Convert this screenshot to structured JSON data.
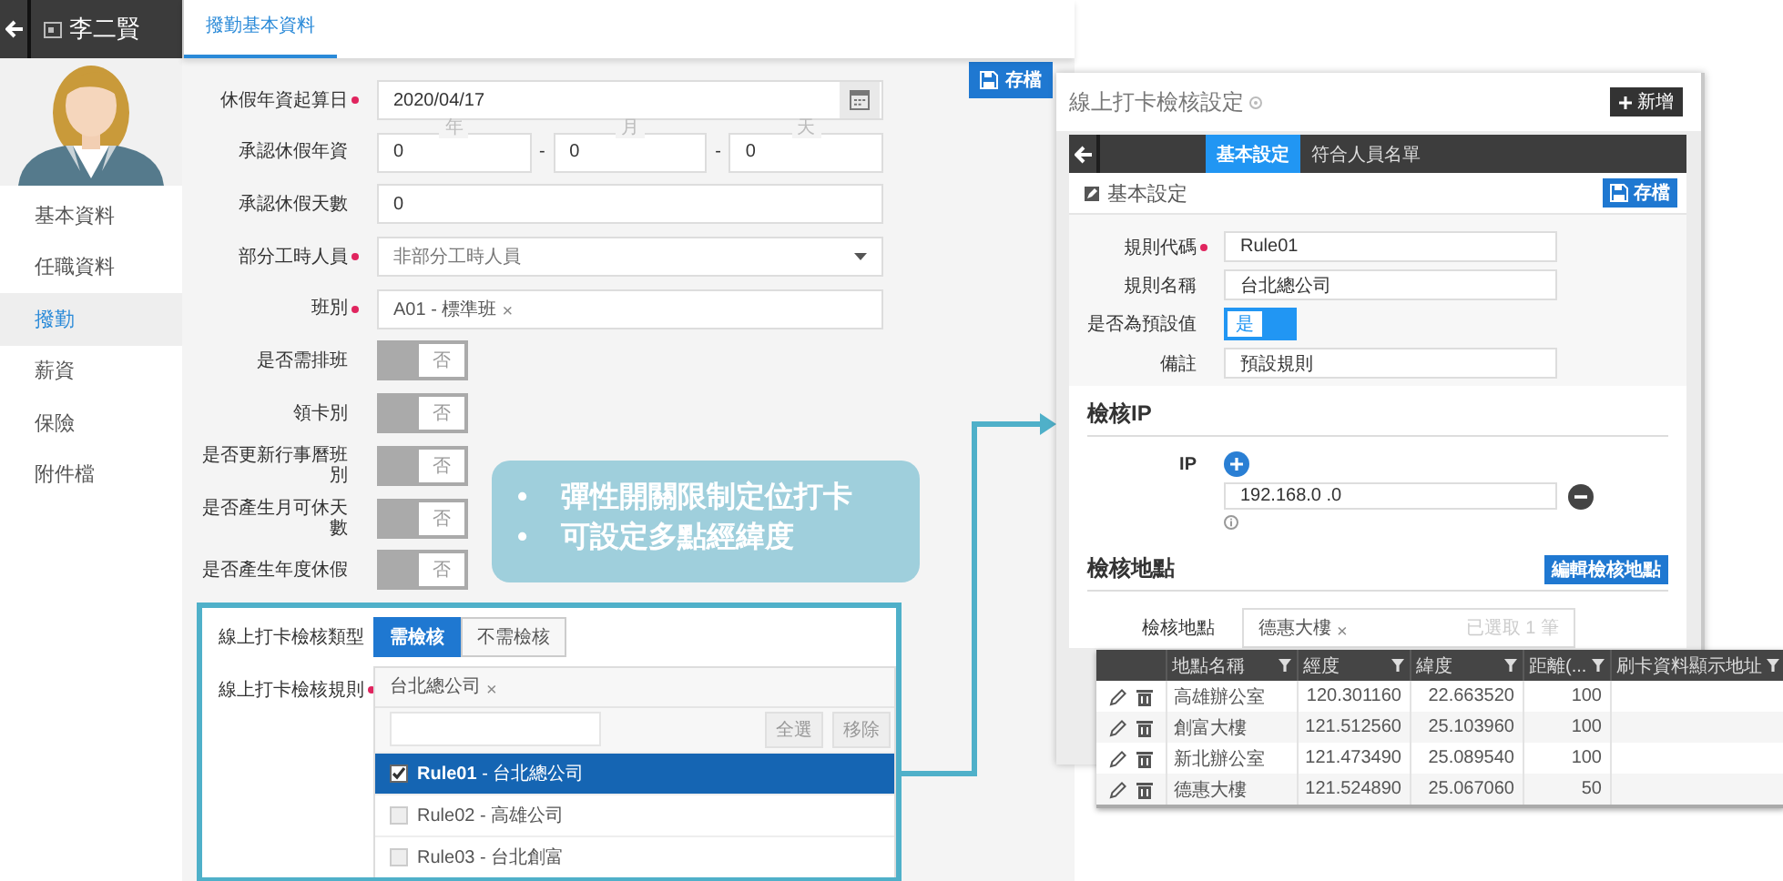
{
  "user": {
    "name": "李二賢"
  },
  "sidebar": {
    "items": [
      {
        "label": "基本資料",
        "selected": false
      },
      {
        "label": "任職資料",
        "selected": false
      },
      {
        "label": "撥勤",
        "selected": true
      },
      {
        "label": "薪資",
        "selected": false
      },
      {
        "label": "保險",
        "selected": false
      },
      {
        "label": "附件檔",
        "selected": false
      }
    ]
  },
  "tabs": [
    {
      "label": "撥勤基本資料",
      "selected": true
    }
  ],
  "save_button": "存檔",
  "form": {
    "fields": [
      {
        "kind": "date",
        "label": "休假年資起算日",
        "required": true,
        "value": "2020/04/17"
      },
      {
        "kind": "split",
        "label": "承認休假年資",
        "required": false,
        "parts": [
          {
            "caption": "年",
            "value": "0"
          },
          {
            "caption": "月",
            "value": "0"
          },
          {
            "caption": "天",
            "value": "0"
          }
        ],
        "separators": [
          "-",
          "-"
        ]
      },
      {
        "kind": "text",
        "label": "承認休假天數",
        "required": false,
        "value": "0"
      },
      {
        "kind": "select",
        "label": "部分工時人員",
        "required": true,
        "value": "非部分工時人員"
      },
      {
        "kind": "tags",
        "label": "班別",
        "required": true,
        "tags": [
          {
            "text": "A01 - 標準班",
            "remove": "×"
          }
        ]
      },
      {
        "kind": "toggle",
        "label": "是否需排班",
        "required": false,
        "on": false,
        "text": "否"
      },
      {
        "kind": "toggle",
        "label": "領卡別",
        "required": false,
        "on": false,
        "text": "否"
      },
      {
        "kind": "toggle",
        "label": "是否更新行事曆班別",
        "required": false,
        "on": false,
        "text": "否"
      },
      {
        "kind": "toggle",
        "label": "是否產生月可休天數",
        "required": false,
        "on": false,
        "text": "否"
      },
      {
        "kind": "toggle",
        "label": "是否產生年度休假",
        "required": false,
        "on": false,
        "text": "否"
      }
    ]
  },
  "online_check": {
    "type_label": "線上打卡檢核類型",
    "type_options": [
      {
        "label": "需檢核",
        "selected": true
      },
      {
        "label": "不需檢核",
        "selected": false
      }
    ],
    "rule_label": "線上打卡檢核規則",
    "rule_required": true,
    "rule_tags": [
      {
        "text": "台北總公司",
        "remove": "×"
      }
    ],
    "actions": [
      "全選",
      "移除"
    ],
    "rules": [
      {
        "label": "**Rule01** - 台北總公司",
        "checked": true,
        "selected": true
      },
      {
        "label": "Rule02 - 高雄公司",
        "checked": false,
        "selected": false
      },
      {
        "label": "Rule03 - 台北創富",
        "checked": false,
        "selected": false
      }
    ]
  },
  "callout": {
    "items": [
      {
        "bullet": "•",
        "text": "彈性開關限制定位打卡"
      },
      {
        "bullet": "•",
        "text": "可設定多點經緯度"
      }
    ]
  },
  "rule_window": {
    "title": "線上打卡檢核設定",
    "add_button": "新增",
    "tabs": [
      {
        "label": "基本設定",
        "selected": true
      },
      {
        "label": "符合人員名單",
        "selected": false
      }
    ],
    "section_title": "基本設定",
    "save_button": "存檔",
    "fields": [
      {
        "kind": "text",
        "label": "規則代碼",
        "required": true,
        "value": "Rule01"
      },
      {
        "kind": "text",
        "label": "規則名稱",
        "required": false,
        "value": "台北總公司"
      },
      {
        "kind": "toggle",
        "label": "是否為預設值",
        "required": false,
        "on": true,
        "text": "是"
      },
      {
        "kind": "text",
        "label": "備註",
        "required": false,
        "value": "預設規則"
      }
    ],
    "ip_section": {
      "title": "檢核IP",
      "label": "IP",
      "values": [
        "192.168.0 .0"
      ]
    },
    "location_section": {
      "title": "檢核地點",
      "edit_button": "編輯檢核地點",
      "label": "檢核地點",
      "tags": [
        {
          "text": "德惠大樓",
          "remove": "×"
        }
      ],
      "hint": "已選取 1 筆"
    }
  },
  "location_table": {
    "columns": [
      "地點名稱",
      "經度",
      "緯度",
      "距離(...",
      "刷卡資料顯示地址"
    ],
    "rows": [
      {
        "name": "高雄辦公室",
        "longitude": "120.301160",
        "latitude": "22.663520",
        "distance": "100"
      },
      {
        "name": "創富大樓",
        "longitude": "121.512560",
        "latitude": "25.103960",
        "distance": "100"
      },
      {
        "name": "新北辦公室",
        "longitude": "121.473490",
        "latitude": "25.089540",
        "distance": "100"
      },
      {
        "name": "德惠大樓",
        "longitude": "121.524890",
        "latitude": "25.067060",
        "distance": "50"
      }
    ]
  }
}
